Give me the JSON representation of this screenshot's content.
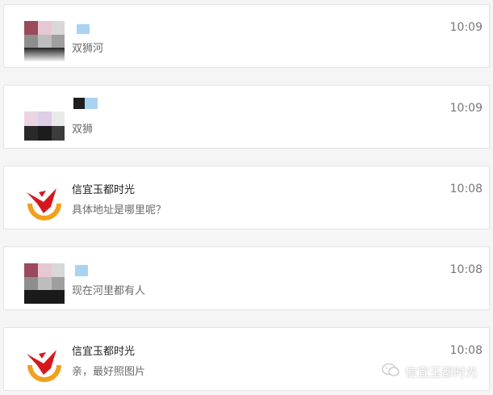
{
  "chats": [
    {
      "name": "",
      "message": "双狮河",
      "time": "10:09"
    },
    {
      "name": "",
      "message": "双狮",
      "time": "10:09"
    },
    {
      "name": "信宜玉都时光",
      "message": "具体地址是哪里呢？",
      "time": "10:08"
    },
    {
      "name": "",
      "message": "现在河里都有人",
      "time": "10:08"
    },
    {
      "name": "信宜玉都时光",
      "message": "亲，最好照图片",
      "time": "10:08"
    }
  ],
  "watermark": {
    "label": "信宜玉都时光"
  },
  "colors": {
    "logo_red": "#d6181e",
    "logo_orange": "#f0a01e",
    "blur_blue": "#a9d3f3"
  },
  "icons": [
    "pixelated-avatar",
    "brand-logo",
    "wechat-icon"
  ]
}
